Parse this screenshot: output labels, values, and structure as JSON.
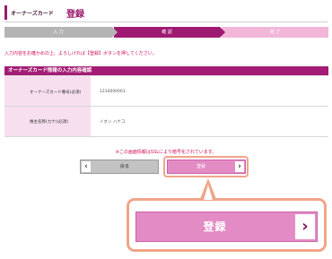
{
  "header": {
    "card_label": "オーナーズカード",
    "title": "登録"
  },
  "steps": [
    {
      "label": "入 力",
      "state": "done"
    },
    {
      "label": "確 認",
      "state": "current"
    },
    {
      "label": "完 了",
      "state": "upcoming"
    }
  ],
  "instruction": "入力内容をお確かめの上、よろしければ【登録】ボタンを押してください。",
  "confirm_section": {
    "title": "オーナーズカード情報の入力内容確認",
    "rows": [
      {
        "label": "オーナーズカード番号(必須)",
        "value": "1234000001"
      },
      {
        "label": "株主名称(カナ)(必須)",
        "value": "イオン ハナコ"
      }
    ]
  },
  "ssl_notice": "※この画面情報はSSLにより暗号化されています。",
  "buttons": {
    "back": {
      "label": "戻る",
      "icon": "chevron-left-icon"
    },
    "register": {
      "label": "登録",
      "icon": "chevron-right-icon"
    }
  },
  "callout": {
    "register_label": "登録",
    "icon": "chevron-right-icon"
  },
  "colors": {
    "brand": "#9e1a72",
    "accent_pink": "#e38bc5",
    "highlight": "#f0a58a",
    "notice_red": "#d0105a"
  }
}
